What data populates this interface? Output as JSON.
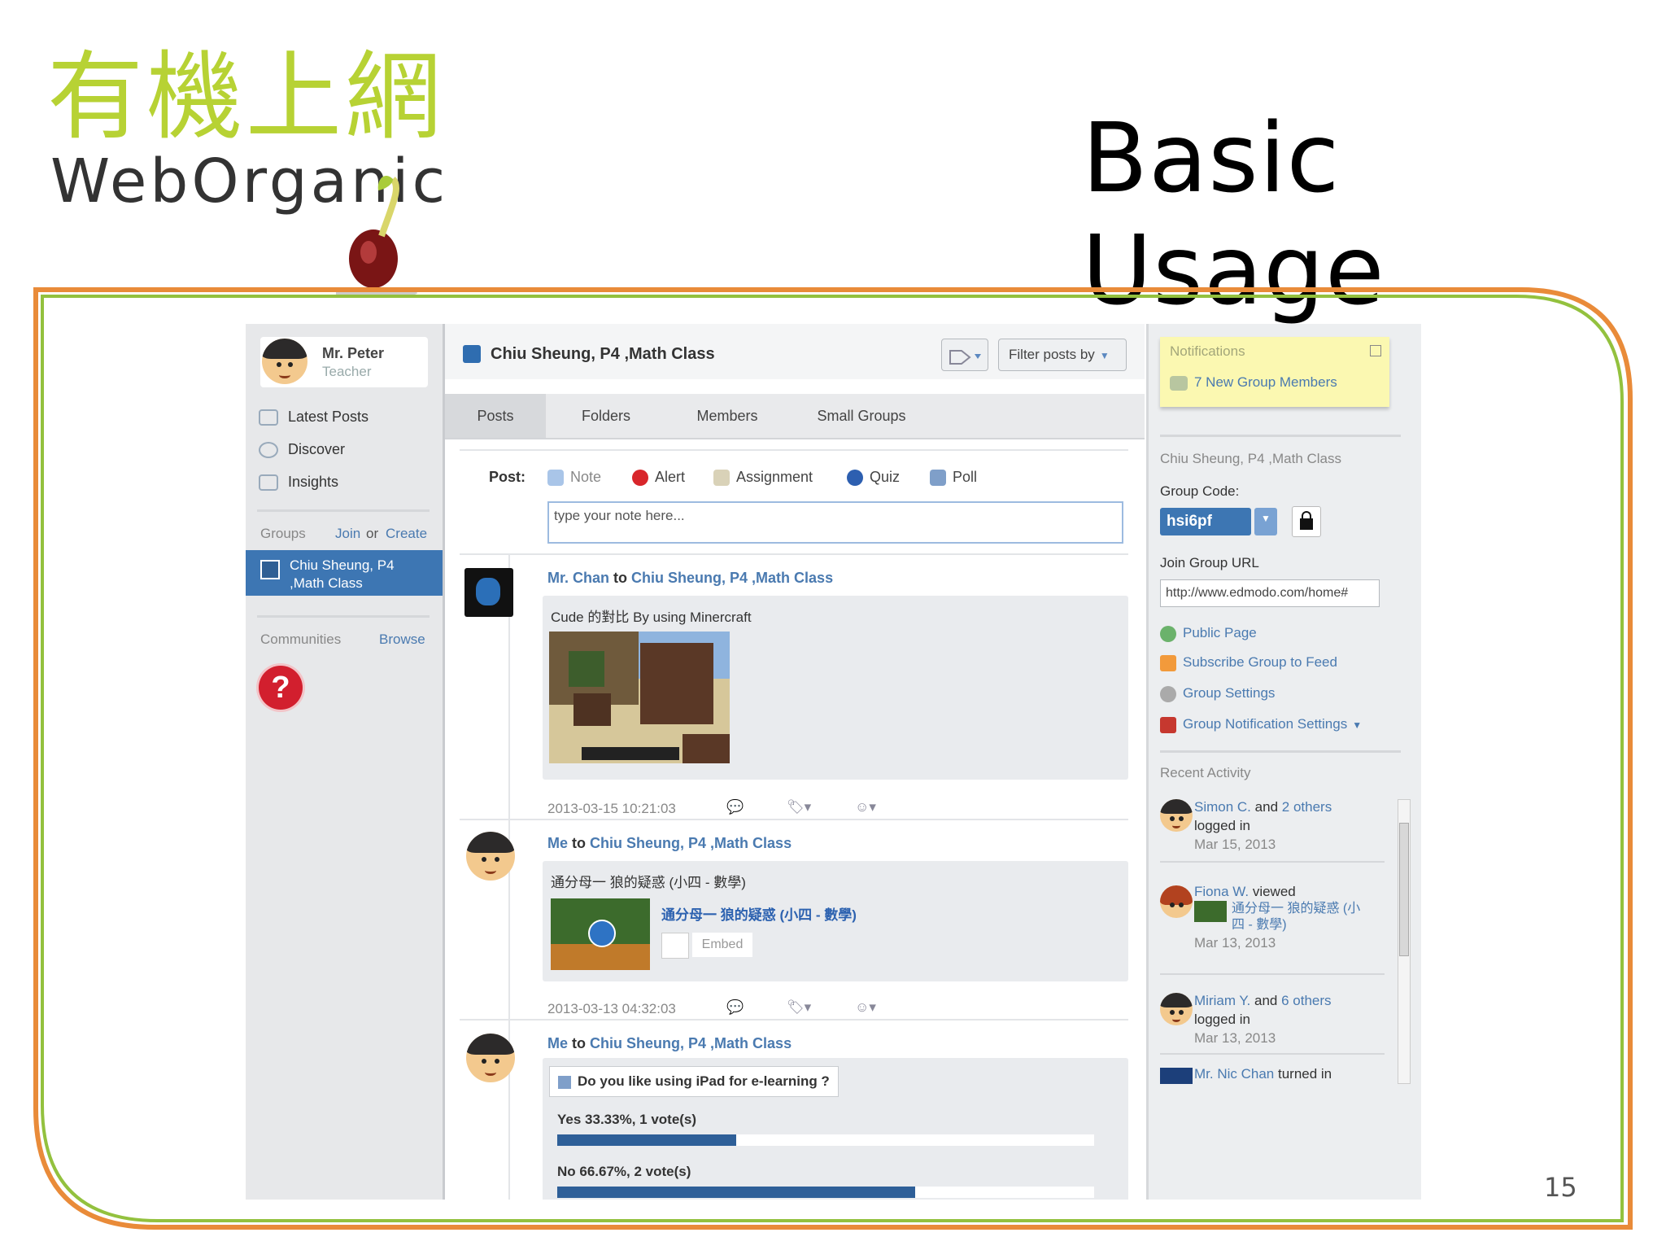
{
  "slide": {
    "title": "Basic Usage",
    "page_number": "15",
    "logo_cjk": "有機上網",
    "logo_en": "WebOrganic"
  },
  "sidebar": {
    "user_name": "Mr. Peter",
    "user_role": "Teacher",
    "nav": [
      "Latest Posts",
      "Discover",
      "Insights"
    ],
    "groups_label": "Groups",
    "join_label": "Join",
    "or_label": "or",
    "create_label": "Create",
    "active_group_line1": "Chiu Sheung, P4",
    "active_group_line2": ",Math Class",
    "communities_label": "Communities",
    "browse_label": "Browse",
    "help_symbol": "?"
  },
  "main": {
    "group_title": "Chiu Sheung, P4 ,Math Class",
    "filter_label": "Filter posts by",
    "tabs": [
      "Posts",
      "Folders",
      "Members",
      "Small Groups"
    ],
    "post_label": "Post:",
    "post_types": [
      "Note",
      "Alert",
      "Assignment",
      "Quiz",
      "Poll"
    ],
    "note_placeholder": "type your note here...",
    "feed": [
      {
        "from": "Mr. Chan",
        "to_word": "to",
        "group": "Chiu Sheung, P4 ,Math Class",
        "text": "Cude 的對比 By using Minercraft",
        "timestamp": "2013-03-15 10:21:03"
      },
      {
        "from": "Me",
        "to_word": "to",
        "group": "Chiu Sheung, P4 ,Math Class",
        "text": "通分母一 狼的疑惑 (小四 - 數學)",
        "link_title": "通分母一 狼的疑惑 (小四 - 數學)",
        "embed_label": "Embed",
        "timestamp": "2013-03-13 04:32:03"
      },
      {
        "from": "Me",
        "to_word": "to",
        "group": "Chiu Sheung, P4 ,Math Class",
        "poll_question": "Do you like using iPad for e-learning ?",
        "poll_options": [
          {
            "label": "Yes 33.33%, 1 vote(s)",
            "fraction": 0.3333
          },
          {
            "label": "No 66.67%, 2 vote(s)",
            "fraction": 0.6667
          }
        ]
      }
    ]
  },
  "right": {
    "notifications_label": "Notifications",
    "notification_item": "7 New Group Members",
    "group_name": "Chiu Sheung, P4 ,Math Class",
    "group_code_label": "Group Code:",
    "group_code": "hsi6pf",
    "join_url_label": "Join Group URL",
    "join_url": "http://www.edmodo.com/home#",
    "links": [
      "Public Page",
      "Subscribe Group to Feed",
      "Group Settings",
      "Group Notification Settings"
    ],
    "recent_label": "Recent Activity",
    "activity": [
      {
        "name": "Simon C.",
        "mid": "and",
        "others": "2 others",
        "action": "logged in",
        "date": "Mar 15, 2013"
      },
      {
        "name": "Fiona W.",
        "action": "viewed",
        "item": "通分母一 狼的疑惑 (小四 - 數學)",
        "date": "Mar 13, 2013"
      },
      {
        "name": "Miriam Y.",
        "mid": "and",
        "others": "6 others",
        "action": "logged in",
        "date": "Mar 13, 2013"
      },
      {
        "name": "Mr. Nic Chan",
        "action": "turned in"
      }
    ]
  },
  "colors": {
    "frame_orange": "#e98b39",
    "frame_green": "#93c13e",
    "accent_blue": "#3d76b3",
    "logo_green": "#b7d234"
  }
}
